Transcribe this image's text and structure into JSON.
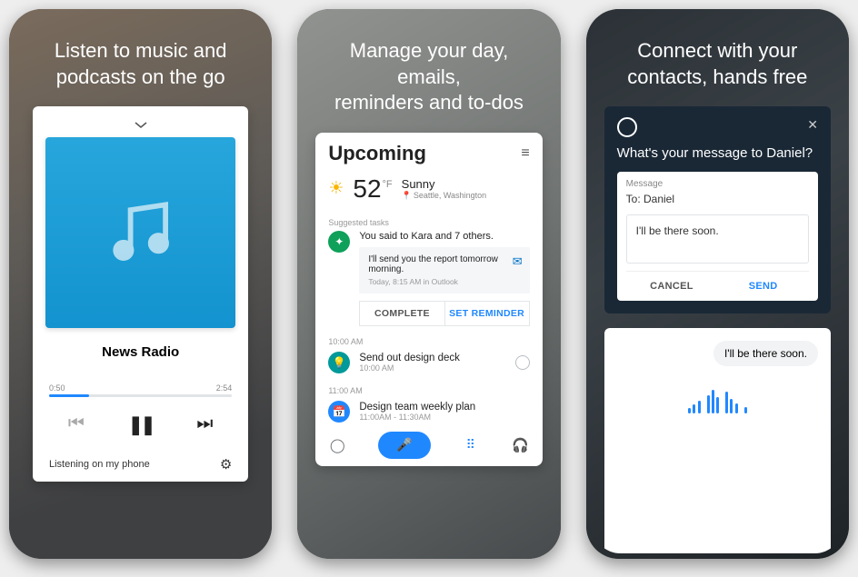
{
  "phone1": {
    "headline_l1": "Listen to music and",
    "headline_l2": "podcasts on the go",
    "track_title": "News Radio",
    "time_start": "0:50",
    "time_end": "2:54",
    "footer_text": "Listening on my phone"
  },
  "phone2": {
    "headline_l1": "Manage your day, emails,",
    "headline_l2": "reminders and to-dos",
    "title": "Upcoming",
    "temp_value": "52",
    "temp_unit": "°F",
    "cond": "Sunny",
    "loc": "Seattle, Washington",
    "sect_label": "Suggested tasks",
    "task_title": "You said to Kara and 7 others.",
    "quote": "I'll send you the report tomorrow morning.",
    "quote_meta": "Today, 8:15 AM in Outlook",
    "complete_label": "COMPLETE",
    "remind_label": "SET REMINDER",
    "time1": "10:00 AM",
    "event1_title": "Send out design deck",
    "event1_sub": "10:00 AM",
    "time2": "11:00 AM",
    "event2_title": "Design team weekly plan",
    "event2_sub": "11:00AM - 11:30AM"
  },
  "phone3": {
    "headline_l1": "Connect with your",
    "headline_l2": "contacts, hands free",
    "prompt": "What's your message to Daniel?",
    "msg_label": "Message",
    "to_line": "To: Daniel",
    "body": "I'll be there soon.",
    "cancel_label": "CANCEL",
    "send_label": "SEND",
    "bubble": "I'll be there soon."
  }
}
